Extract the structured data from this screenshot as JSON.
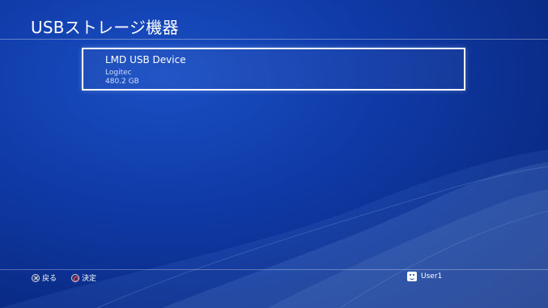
{
  "header": {
    "title": "USBストレージ機器"
  },
  "device": {
    "name": "LMD USB Device",
    "vendor": "Logitec",
    "size": "480.2 GB"
  },
  "footer": {
    "back_label": "戻る",
    "confirm_label": "決定",
    "user_name": "User1"
  },
  "icons": {
    "back": "cross-button-icon",
    "confirm": "circle-button-icon",
    "user": "user-avatar-icon"
  },
  "colors": {
    "background": "#0f3aa6",
    "text": "#ffffff",
    "card_border": "#ffffff"
  }
}
